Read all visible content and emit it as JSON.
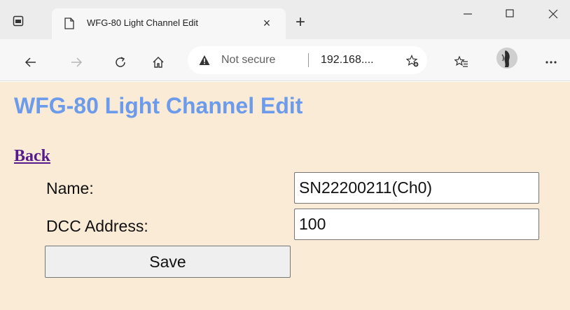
{
  "browser": {
    "tab": {
      "title": "WFG-80 Light Channel Edit"
    },
    "address": {
      "security_label": "Not secure",
      "url": "192.168...."
    }
  },
  "page": {
    "title": "WFG-80 Light Channel Edit",
    "back_label": "Back",
    "form": {
      "name_label": "Name:",
      "name_value": "SN22200211(Ch0)",
      "dcc_label": "DCC Address:",
      "dcc_value": "100",
      "save_label": "Save"
    }
  },
  "colors": {
    "page_background": "#faebd7",
    "title": "#6b9bea",
    "link": "#551a8b"
  }
}
